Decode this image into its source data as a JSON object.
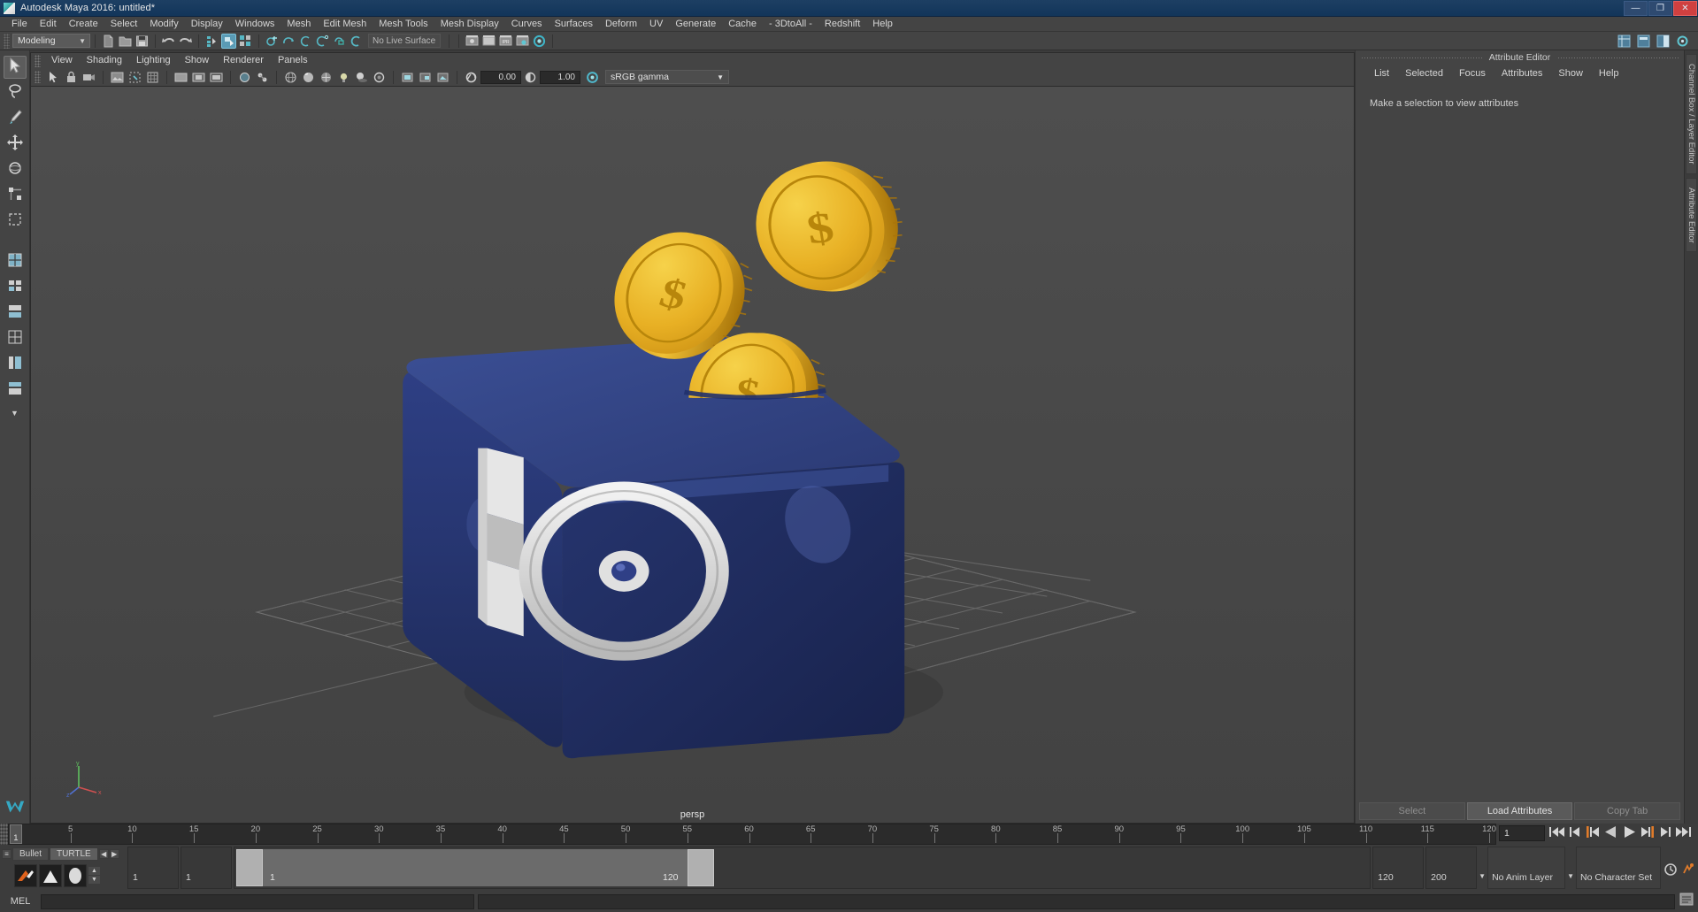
{
  "window": {
    "title": "Autodesk Maya 2016: untitled*",
    "icon": "maya-icon",
    "buttons": [
      {
        "name": "minimize-button",
        "glyph": "—"
      },
      {
        "name": "maximize-button",
        "glyph": "❐"
      },
      {
        "name": "close-button",
        "glyph": "✕"
      }
    ]
  },
  "menubar": {
    "items": [
      {
        "label": "File"
      },
      {
        "label": "Edit"
      },
      {
        "label": "Create"
      },
      {
        "label": "Select"
      },
      {
        "label": "Modify"
      },
      {
        "label": "Display"
      },
      {
        "label": "Windows"
      },
      {
        "label": "Mesh"
      },
      {
        "label": "Edit Mesh"
      },
      {
        "label": "Mesh Tools"
      },
      {
        "label": "Mesh Display"
      },
      {
        "label": "Curves"
      },
      {
        "label": "Surfaces"
      },
      {
        "label": "Deform"
      },
      {
        "label": "UV"
      },
      {
        "label": "Generate"
      },
      {
        "label": "Cache"
      },
      {
        "label": "- 3DtoAll -"
      },
      {
        "label": "Redshift"
      },
      {
        "label": "Help"
      }
    ]
  },
  "statusbar": {
    "mode_menu": "Modeling",
    "live_surface": "No Live Surface",
    "icons": [
      "new-scene-icon",
      "open-scene-icon",
      "save-scene-icon",
      "undo-icon",
      "redo-icon",
      "select-by-hierarchy-icon",
      "select-by-object-icon",
      "select-by-component-icon",
      "snap-to-grid-icon",
      "snap-to-curve-icon",
      "snap-to-point-icon",
      "snap-to-projected-center-icon",
      "snap-to-view-plane-icon",
      "make-live-icon",
      "render-current-frame-icon",
      "ipr-render-icon",
      "render-settings-icon",
      "hypershade-icon",
      "render-view-icon",
      "show-channel-box-icon",
      "show-layer-editor-icon",
      "show-attribute-editor-icon",
      "show-tool-settings-icon"
    ]
  },
  "toolbox": {
    "items": [
      {
        "name": "select-tool",
        "icon": "arrow-cursor-icon",
        "active": true
      },
      {
        "name": "lasso-tool",
        "icon": "lasso-icon",
        "active": false
      },
      {
        "name": "paint-select-tool",
        "icon": "paint-brush-icon",
        "active": false
      },
      {
        "name": "move-tool",
        "icon": "move-arrows-icon",
        "active": false
      },
      {
        "name": "rotate-tool",
        "icon": "rotate-ring-icon",
        "active": false
      },
      {
        "name": "scale-tool",
        "icon": "scale-box-icon",
        "active": false
      },
      {
        "name": "last-tool",
        "icon": "last-tool-icon",
        "active": false
      },
      {
        "name": "layout-single-pane",
        "icon": "single-pane-icon",
        "active": false
      },
      {
        "name": "layout-two-pane-side",
        "icon": "two-pane-side-icon",
        "active": false
      },
      {
        "name": "layout-two-pane-stacked",
        "icon": "two-pane-stacked-icon",
        "active": false
      },
      {
        "name": "layout-four-pane",
        "icon": "four-pane-icon",
        "active": false
      },
      {
        "name": "layout-persp-outliner",
        "icon": "persp-outliner-icon",
        "active": false
      },
      {
        "name": "layout-hypershade",
        "icon": "hypershade-layout-icon",
        "active": false
      },
      {
        "name": "layout-more",
        "icon": "chevron-down-icon",
        "active": false
      }
    ]
  },
  "viewport": {
    "menus": [
      "View",
      "Shading",
      "Lighting",
      "Show",
      "Renderer",
      "Panels"
    ],
    "camera_label": "persp",
    "toolbar": {
      "exposure_value": "0.00",
      "gamma_value": "1.00",
      "color_space": "sRGB gamma",
      "icons": [
        "select-camera-icon",
        "lock-camera-icon",
        "camera-attributes-icon",
        "image-plane-icon",
        "two-d-pan-zoom-icon",
        "grid-toggle-icon",
        "film-gate-icon",
        "resolution-gate-icon",
        "gate-mask-icon",
        "xray-toggle-icon",
        "xray-joints-icon",
        "wireframe-icon",
        "smooth-shade-icon",
        "textured-icon",
        "use-all-lights-icon",
        "shadows-icon",
        "ambient-occlusion-icon",
        "motion-blur-icon",
        "multisample-icon",
        "depth-of-field-icon",
        "isolate-select-icon",
        "exposure-icon",
        "gamma-icon",
        "color-management-icon"
      ]
    },
    "scene": {
      "objects": [
        {
          "name": "piggy-bank-cube",
          "color": "#2c3e7a"
        },
        {
          "name": "coin-back",
          "color": "#e8b024"
        },
        {
          "name": "coin-middle",
          "color": "#e8b024"
        },
        {
          "name": "coin-front",
          "color": "#e8b024"
        },
        {
          "name": "safe-wheel-handle",
          "color": "#d8d8d8"
        },
        {
          "name": "grid-floor",
          "color": "#6a6a6a"
        }
      ],
      "axis_gizmo": {
        "x": "x",
        "y": "y",
        "z": "z"
      }
    }
  },
  "attribute_editor": {
    "panel_title": "Attribute Editor",
    "menus": [
      "List",
      "Selected",
      "Focus",
      "Attributes",
      "Show",
      "Help"
    ],
    "empty_message": "Make a selection to view attributes",
    "buttons": [
      {
        "label": "Select",
        "disabled": true
      },
      {
        "label": "Load Attributes",
        "disabled": false
      },
      {
        "label": "Copy Tab",
        "disabled": true
      }
    ]
  },
  "side_tabs": [
    {
      "label": "Channel Box / Layer Editor"
    },
    {
      "label": "Attribute Editor"
    }
  ],
  "timeslider": {
    "current_frame": "1",
    "start_label": "1",
    "ticks": [
      5,
      10,
      15,
      20,
      25,
      30,
      35,
      40,
      45,
      50,
      55,
      60,
      65,
      70,
      75,
      80,
      85,
      90,
      95,
      100,
      105,
      110,
      115,
      120
    ],
    "range_start": 1,
    "range_end": 120,
    "playback_buttons": [
      {
        "name": "go-to-start-button",
        "glyph": "start"
      },
      {
        "name": "step-back-button",
        "glyph": "stepback"
      },
      {
        "name": "previous-key-button",
        "glyph": "prevkey"
      },
      {
        "name": "play-backwards-button",
        "glyph": "playback"
      },
      {
        "name": "play-forwards-button",
        "glyph": "playfwd"
      },
      {
        "name": "next-key-button",
        "glyph": "nextkey"
      },
      {
        "name": "step-forward-button",
        "glyph": "stepfwd"
      },
      {
        "name": "go-to-end-button",
        "glyph": "end"
      }
    ]
  },
  "rangeslider": {
    "shelf_tabs": [
      {
        "label": "Bullet",
        "active": false
      },
      {
        "label": "TURTLE",
        "active": true
      }
    ],
    "anim_start": "1",
    "playback_start": "1",
    "slider_start_label": "1",
    "slider_end_label": "120",
    "playback_end": "120",
    "anim_end": "200",
    "anim_layer": "No Anim Layer",
    "character_set": "No Character Set",
    "right_icons": [
      "auto-keyframe-icon",
      "animation-preferences-icon"
    ]
  },
  "command_line": {
    "label": "MEL",
    "input_value": "",
    "output_value": "",
    "script_editor_icon": "script-editor-icon"
  }
}
